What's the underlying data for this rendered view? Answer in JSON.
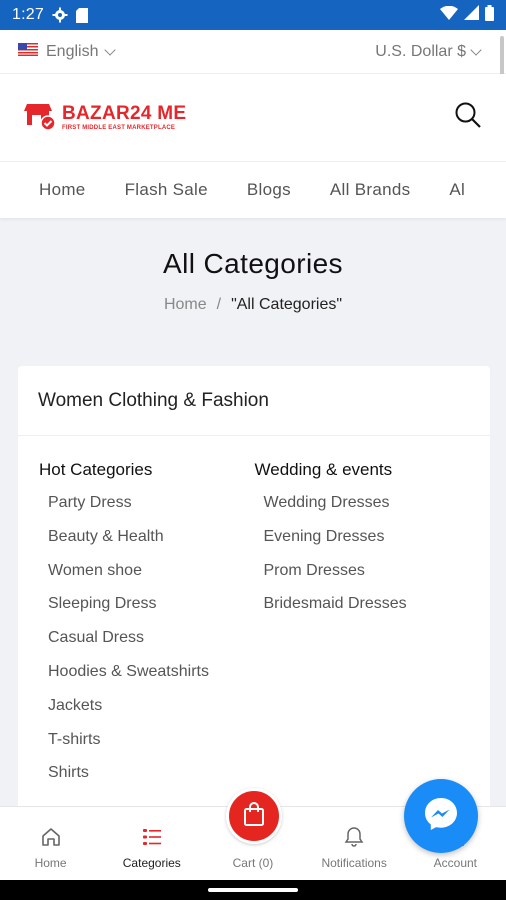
{
  "status_bar": {
    "time": "1:27"
  },
  "top_util": {
    "language": "English",
    "currency": "U.S. Dollar $"
  },
  "header": {
    "logo_name": "BAZAR24 ME",
    "logo_tagline": "FIRST MIDDLE EAST MARKETPLACE"
  },
  "nav": {
    "items": [
      "Home",
      "Flash Sale",
      "Blogs",
      "All Brands",
      "Al"
    ]
  },
  "page": {
    "title": "All Categories",
    "breadcrumb_home": "Home",
    "breadcrumb_sep": "/",
    "breadcrumb_current": "\"All Categories\""
  },
  "card": {
    "title": "Women Clothing & Fashion",
    "columns": [
      {
        "title": "Hot Categories",
        "items": [
          "Party Dress",
          "Beauty & Health",
          "Women shoe",
          "Sleeping Dress",
          "Casual Dress",
          "Hoodies & Sweatshirts",
          "Jackets",
          "T-shirts",
          "Shirts"
        ]
      },
      {
        "title": "Wedding & events",
        "items": [
          "Wedding Dresses",
          "Evening Dresses",
          "Prom Dresses",
          "Bridesmaid Dresses"
        ]
      }
    ]
  },
  "bottom_nav": {
    "home": "Home",
    "categories": "Categories",
    "cart": "Cart (0)",
    "notifications": "Notifications",
    "account": "Account"
  },
  "colors": {
    "status_bar": "#1565c0",
    "brand_red": "#e5262a",
    "messenger_blue": "#1a8cf7"
  },
  "icons": [
    "settings-icon",
    "sim-icon",
    "wifi-icon",
    "signal-icon",
    "battery-icon",
    "us-flag-icon",
    "chevron-down-icon",
    "search-icon",
    "home-icon",
    "categories-icon",
    "cart-bag-icon",
    "bell-icon",
    "account-icon",
    "messenger-icon"
  ]
}
